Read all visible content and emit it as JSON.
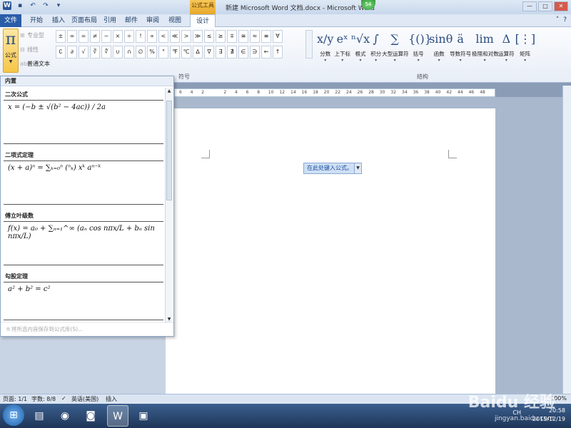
{
  "titlebar": {
    "title": "新建 Microsoft Word 文档.docx - Microsoft Word",
    "tools_tag": "公式工具",
    "badge": "54",
    "minimize": "—",
    "restore": "□",
    "close": "✕"
  },
  "tabs": [
    "文件",
    "开始",
    "插入",
    "页面布局",
    "引用",
    "邮件",
    "审阅",
    "视图",
    "设计"
  ],
  "tools": {
    "pi_symbol": "π",
    "formula_label": "公式",
    "professional": "专业型",
    "linear": "线性",
    "normal_text": "普通文本"
  },
  "symbols": {
    "row1": [
      "±",
      "∞",
      "=",
      "≠",
      "~",
      "×",
      "÷",
      "!",
      "∝",
      "<",
      "≪",
      ">",
      "≫",
      "≤",
      "≥",
      "∓",
      "≅",
      "≈",
      "≡",
      "∀"
    ],
    "row2": [
      "∁",
      "∂",
      "√",
      "∛",
      "∜",
      "∪",
      "∩",
      "∅",
      "%",
      "°",
      "℉",
      "℃",
      "∆",
      "∇",
      "∃",
      "∄",
      "∈",
      "∋",
      "←",
      "↑"
    ],
    "group_label": "符号"
  },
  "structures": {
    "items": [
      {
        "sym": "x/y",
        "label": "分数"
      },
      {
        "sym": "eˣ",
        "label": "上下标"
      },
      {
        "sym": "ⁿ√x",
        "label": "根式"
      },
      {
        "sym": "∫",
        "label": "积分"
      },
      {
        "sym": "∑",
        "label": "大型运算符"
      },
      {
        "sym": "{()}",
        "label": "括号"
      },
      {
        "sym": "sinθ",
        "label": "函数"
      },
      {
        "sym": "ä",
        "label": "导数符号"
      },
      {
        "sym": "lim",
        "label": "极限和对数"
      },
      {
        "sym": "Δ",
        "label": "运算符"
      },
      {
        "sym": "[⋮]",
        "label": "矩阵"
      }
    ],
    "group_label": "结构"
  },
  "gallery": {
    "header": "内置",
    "sections": [
      {
        "title": "二次公式",
        "formula": "x = (−b ± √(b² − 4ac)) / 2a"
      },
      {
        "title": "二项式定理",
        "formula": "(x + a)ⁿ = ∑ₖ₌₀ⁿ (ⁿₖ) xᵏ aⁿ⁻ᵏ"
      },
      {
        "title": "傅立叶级数",
        "formula": "f(x) = a₀ + ∑ₙ₌₁^∞ (aₙ cos nπx/L + bₙ sin nπx/L)"
      },
      {
        "title": "勾股定理",
        "formula": "a² + b² = c²"
      }
    ],
    "footer": "将所选内容保存到公式库(S)..."
  },
  "document": {
    "equation_placeholder": "在此处键入公式。",
    "ruler_marks": [
      "6",
      "4",
      "2",
      "",
      "2",
      "4",
      "6",
      "8",
      "10",
      "12",
      "14",
      "16",
      "18",
      "20",
      "22",
      "24",
      "26",
      "28",
      "30",
      "32",
      "34",
      "36",
      "38",
      "40",
      "42",
      "44",
      "46",
      "48"
    ]
  },
  "statusbar": {
    "page": "页面: 1/1",
    "words": "字数: 8/8",
    "lang": "英语(美国)",
    "mode": "插入",
    "zoom": "100%"
  },
  "taskbar": {
    "time": "20:58",
    "date": "2015/12/19",
    "lang": "CH"
  },
  "watermark": {
    "brand": "Baidu 经验",
    "url": "jingyan.baidu.com"
  }
}
